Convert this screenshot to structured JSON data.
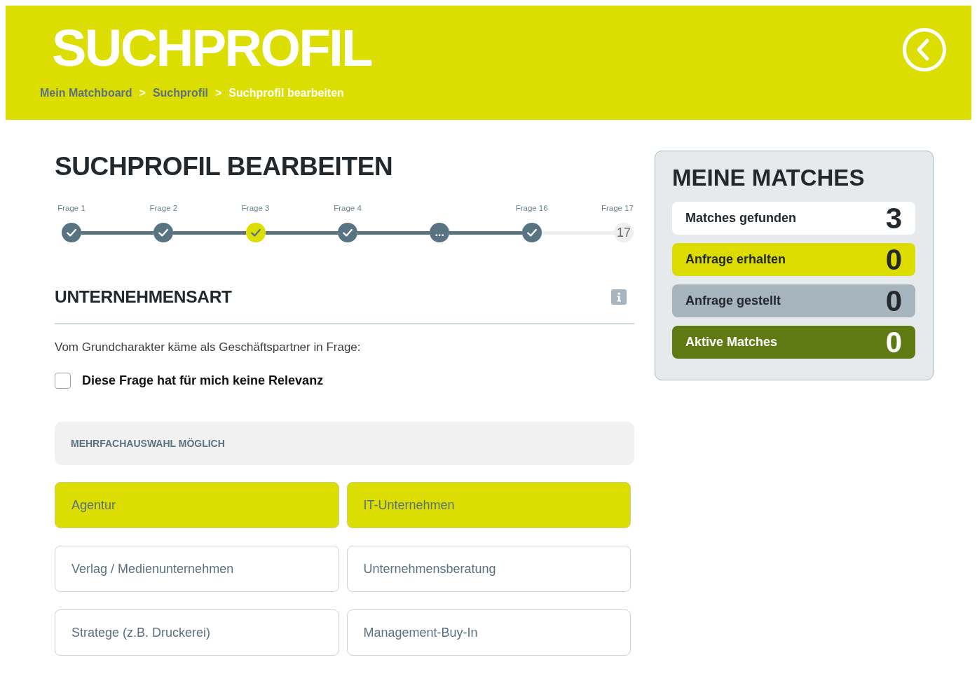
{
  "header": {
    "title": "SUCHPROFIL",
    "breadcrumb": [
      {
        "kind": "link",
        "label": "Mein Matchboard",
        "current": false
      },
      {
        "kind": "separator",
        "label": ">"
      },
      {
        "kind": "link",
        "label": "Suchprofil",
        "current": false
      },
      {
        "kind": "separator",
        "label": ">"
      },
      {
        "kind": "link",
        "label": "Suchprofil bearbeiten",
        "current": true
      }
    ]
  },
  "page_title": "SUCHPROFIL BEARBEITEN",
  "steps": [
    {
      "label": "Frage 1",
      "kind": "check",
      "done": true,
      "current": false
    },
    {
      "label": "Frage 2",
      "kind": "check",
      "done": true,
      "current": false
    },
    {
      "label": "Frage 3",
      "kind": "check",
      "done": true,
      "current": true
    },
    {
      "label": "Frage 4",
      "kind": "check",
      "done": true,
      "current": false
    },
    {
      "kind": "text",
      "marker": "...",
      "done": true,
      "current": false
    },
    {
      "label": "Frage 16",
      "kind": "check",
      "done": true,
      "current": false
    },
    {
      "label": "Frage 17",
      "kind": "text",
      "marker": "17",
      "done": false,
      "current": false
    }
  ],
  "question": {
    "title": "UNTERNEHMENSART",
    "text": "Vom Grundcharakter käme als Geschäftspartner in Frage:",
    "no_relevance": {
      "label": "Diese Frage hat für mich keine Relevanz",
      "checked": false
    },
    "hint": "MEHRFACHAUSWAHL MÖGLICH",
    "options": [
      {
        "label": "Agentur",
        "selected": true
      },
      {
        "label": "IT-Unternehmen",
        "selected": true
      },
      {
        "label": "Verlag / Medienunternehmen",
        "selected": false
      },
      {
        "label": "Unternehmensberatung",
        "selected": false
      },
      {
        "label": "Stratege (z.B. Druckerei)",
        "selected": false
      },
      {
        "label": "Management-Buy-In",
        "selected": false
      }
    ]
  },
  "matches": {
    "title": "MEINE MATCHES",
    "items": [
      {
        "label": "Matches gefunden",
        "value": "3",
        "color": "#ffffff"
      },
      {
        "label": "Anfrage erhalten",
        "value": "0",
        "color": "#dcdc00"
      },
      {
        "label": "Anfrage gestellt",
        "value": "0",
        "color": "#a6b4bd"
      },
      {
        "label": "Aktive Matches",
        "value": "0",
        "color": "#5f7a12"
      }
    ]
  }
}
